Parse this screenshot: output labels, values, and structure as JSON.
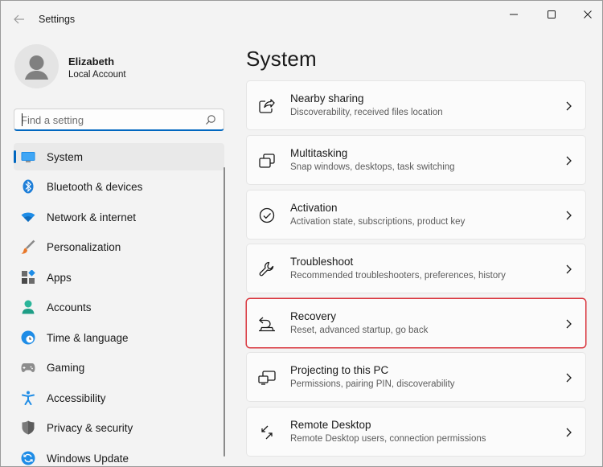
{
  "window": {
    "title": "Settings"
  },
  "profile": {
    "name": "Elizabeth",
    "account_type": "Local Account"
  },
  "search": {
    "placeholder": "Find a setting",
    "value": ""
  },
  "nav": {
    "active": "System",
    "items": [
      {
        "label": "System",
        "icon": "monitor-icon"
      },
      {
        "label": "Bluetooth & devices",
        "icon": "bluetooth-icon"
      },
      {
        "label": "Network & internet",
        "icon": "wifi-icon"
      },
      {
        "label": "Personalization",
        "icon": "paintbrush-icon"
      },
      {
        "label": "Apps",
        "icon": "apps-icon"
      },
      {
        "label": "Accounts",
        "icon": "person-icon"
      },
      {
        "label": "Time & language",
        "icon": "globe-clock-icon"
      },
      {
        "label": "Gaming",
        "icon": "gamepad-icon"
      },
      {
        "label": "Accessibility",
        "icon": "accessibility-icon"
      },
      {
        "label": "Privacy & security",
        "icon": "shield-icon"
      },
      {
        "label": "Windows Update",
        "icon": "update-icon"
      }
    ]
  },
  "main": {
    "title": "System",
    "cards": [
      {
        "title": "Nearby sharing",
        "desc": "Discoverability, received files location",
        "icon": "share-icon"
      },
      {
        "title": "Multitasking",
        "desc": "Snap windows, desktops, task switching",
        "icon": "multitask-icon"
      },
      {
        "title": "Activation",
        "desc": "Activation state, subscriptions, product key",
        "icon": "check-circle-icon"
      },
      {
        "title": "Troubleshoot",
        "desc": "Recommended troubleshooters, preferences, history",
        "icon": "wrench-icon"
      },
      {
        "title": "Recovery",
        "desc": "Reset, advanced startup, go back",
        "icon": "recovery-icon",
        "highlighted": true
      },
      {
        "title": "Projecting to this PC",
        "desc": "Permissions, pairing PIN, discoverability",
        "icon": "project-icon"
      },
      {
        "title": "Remote Desktop",
        "desc": "Remote Desktop users, connection permissions",
        "icon": "remote-desktop-icon"
      }
    ]
  },
  "colors": {
    "accent": "#0067c0",
    "highlight_border": "#d9363e",
    "background": "#f3f3f3"
  }
}
